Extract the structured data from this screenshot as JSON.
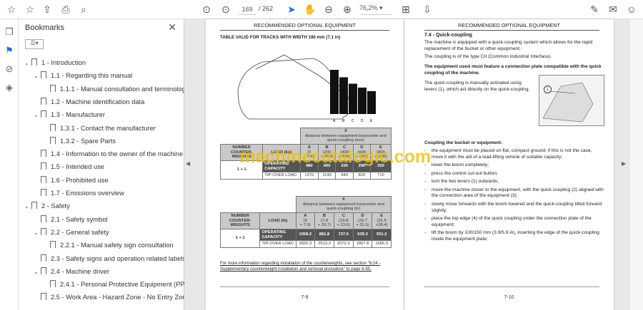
{
  "toolbar": {
    "page_current": "169",
    "page_total": "/ 262",
    "zoom": "76,2%"
  },
  "panel": {
    "title": "Bookmarks"
  },
  "bookmarks": [
    {
      "label": "1  -  Introduction",
      "level": 0,
      "expanded": true
    },
    {
      "label": "1.1 - Regarding this manual",
      "level": 1,
      "expanded": true
    },
    {
      "label": "1.1.1 - Manual consultation and terminology",
      "level": 2
    },
    {
      "label": "1.2 - Machine identification data",
      "level": 1
    },
    {
      "label": "1.3 - Manufacturer",
      "level": 1,
      "expanded": true
    },
    {
      "label": "1.3.1 - Contact the manufacturer",
      "level": 2
    },
    {
      "label": "1.3.2 - Spare Parts",
      "level": 2
    },
    {
      "label": "1.4 - Information to the owner of the machine",
      "level": 1
    },
    {
      "label": "1.5 - Intended use",
      "level": 1
    },
    {
      "label": "1.6 - Prohibited use",
      "level": 1
    },
    {
      "label": "1.7 - Emissions overview",
      "level": 1
    },
    {
      "label": "2  -  Safety",
      "level": 0,
      "expanded": true
    },
    {
      "label": "2.1 - Safety symbol",
      "level": 1
    },
    {
      "label": "2.2 - General safety",
      "level": 1,
      "expanded": true
    },
    {
      "label": "2.2.1 - Manual safety sign consultation",
      "level": 2
    },
    {
      "label": "2.3 - Safety signs and operation related labels",
      "level": 1
    },
    {
      "label": "2.4 - Machine driver",
      "level": 1,
      "expanded": true
    },
    {
      "label": "2.4.1 - Personal Protective Equipment (PPE)",
      "level": 2
    },
    {
      "label": "2.5 - Work Area - Hazard Zone - No Entry Zone",
      "level": 1
    }
  ],
  "left_page": {
    "header": "RECOMMENDED OPTIONAL EQUIPMENT",
    "subtitle": "TABLE VALID FOR TRACKS WITH WIDTH 180 mm (7.1 in)",
    "bar_labels": [
      "A",
      "B",
      "C",
      "D",
      "E"
    ],
    "table_mm": {
      "x": "X",
      "x_desc": "distance between equipment barycentre and quick-coupling (mm)",
      "col1": "NUMBER COUNTER-WEIGHTS",
      "col2": "LOAD (kg)",
      "cols": [
        [
          "A",
          "(0",
          "÷ 200)"
        ],
        [
          "B",
          "(200",
          "÷ 400)"
        ],
        [
          "C",
          "(400",
          "÷ 600)"
        ],
        [
          "D",
          "(600",
          "÷ 800)"
        ],
        [
          "E",
          "(800",
          "÷1000)"
        ]
      ],
      "group": "1 + 1",
      "row1": "OPERATING CAPACITY",
      "row1_vals": [
        "480",
        "400",
        "330",
        "290",
        "250"
      ],
      "row2": "TIP-OVER LOAD",
      "row2_vals": [
        "1370",
        "1140",
        "940",
        "820",
        "710"
      ]
    },
    "table_in": {
      "x": "X",
      "x_desc": "distance between equipment barycentre and quick-coupling (in)",
      "col1": "NUMBER COUNTER-WEIGHTS",
      "col2": "LOAD (lb)",
      "cols": [
        [
          "A",
          "(0",
          "+ 7.9)"
        ],
        [
          "B",
          "(7.9",
          "+ 15.7)"
        ],
        [
          "C",
          "(15.8",
          "+ 23.6)"
        ],
        [
          "D",
          "(23.7",
          "+ 31.5)"
        ],
        [
          "E",
          "(31.5",
          "+39.4)"
        ]
      ],
      "group": "1 + 1",
      "row1": "OPERATING CAPACITY",
      "row1_vals": [
        "1058.2",
        "881.8",
        "727.5",
        "639.3",
        "551.2"
      ],
      "row2": "TIP-OVER LOAD",
      "row2_vals": [
        "3020.3",
        "2513.3",
        "2072.3",
        "1807.8",
        "1565.3"
      ]
    },
    "note": "For more information regarding installation of the counterweights, see section \"6.24 - Supplementary counterweight installation and removal procedure\" to page 6-55.",
    "page_number": "7-9"
  },
  "right_page": {
    "header": "RECOMMENDED OPTIONAL EQUIPMENT",
    "section": "7.4 - Quick-coupling",
    "p1": "The machine is equipped with a quick-coupling system which allows for the rapid replacement of the bucket or other equipment.",
    "p2": "The coupling is of the type CII (Common Industrial Interface).",
    "p3": "The equipment used must feature a connection plate compatible with the quick coupling of the machine.",
    "p4": "The quick-coupling is manually activated using levers (1), which act directly on the quick-coupling.",
    "callout": "1",
    "p5": "Coupling the bucket or equipment:",
    "steps": [
      "the equipment must be placed on flat, compact ground; if this is not the case, move it with the aid of a load-lifting vehicle of suitable capacity;",
      "lower the boom completely;",
      "press the control cut-out button;",
      "turn the two levers (1) outwards;",
      "move the machine closer to the equipment, with the quick coupling (2) aligned with the connection area of the equipment (3).",
      "slowly move forwards with the boom lowered and the quick-coupling tilted forward slightly;",
      "place the top edge (4) of the quick coupling under the connection plate of the equipment;",
      "lift the boom by 100/150 mm (3.9/5.9 in), inserting the edge of the quick-coupling inside the equipment plate;"
    ],
    "page_number": "7-10"
  },
  "watermark": "machinecatalogic.com"
}
